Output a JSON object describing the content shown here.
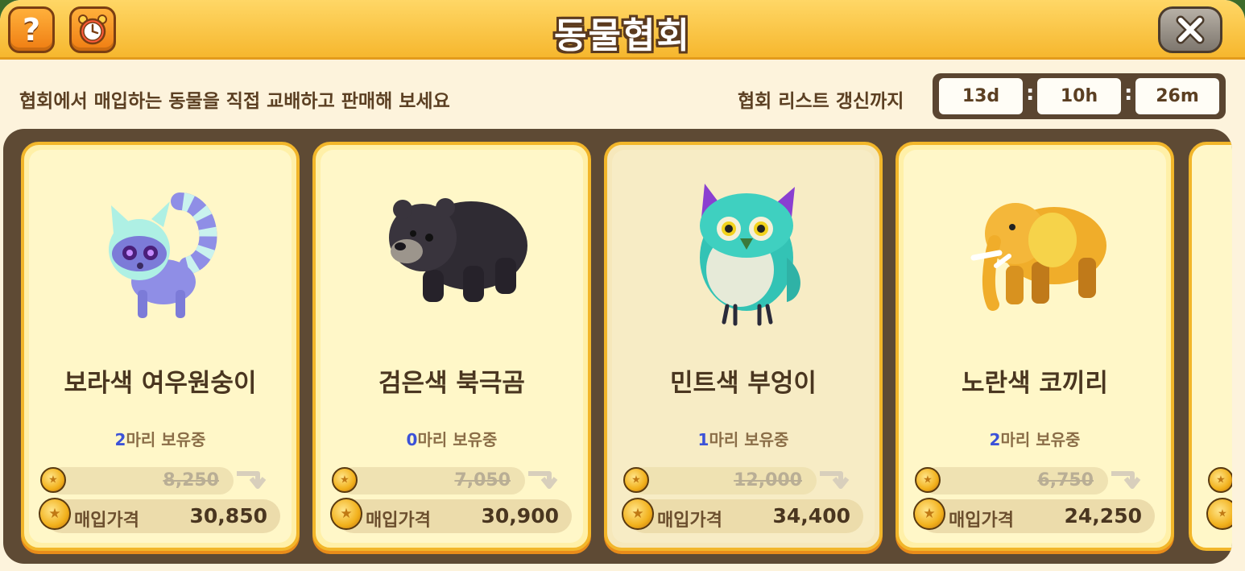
{
  "window": {
    "title": "동물협회",
    "subtitle": "협회에서 매입하는 동물을 직접 교배하고 판매해 보세요",
    "refresh_label": "협회 리스트 갱신까지",
    "help_label": "?"
  },
  "timer": {
    "days": "13d",
    "hours": "10h",
    "minutes": "26m",
    "separator": ":"
  },
  "cards": [
    {
      "name": "보라색 여우원숭이",
      "owned_count": "2",
      "owned_suffix": "마리 보유중",
      "old_price": "8,250",
      "buy_label": "매입가격",
      "buy_price": "30,850",
      "icon": "lemur-icon",
      "color": "#8f8ee6"
    },
    {
      "name": "검은색 북극곰",
      "owned_count": "0",
      "owned_suffix": "마리 보유중",
      "old_price": "7,050",
      "buy_label": "매입가격",
      "buy_price": "30,900",
      "icon": "bear-icon",
      "color": "#2f2b33"
    },
    {
      "name": "민트색 부엉이",
      "owned_count": "1",
      "owned_suffix": "마리 보유중",
      "old_price": "12,000",
      "buy_label": "매입가격",
      "buy_price": "34,400",
      "icon": "owl-icon",
      "color": "#33c3b5"
    },
    {
      "name": "노란색 코끼리",
      "owned_count": "2",
      "owned_suffix": "마리 보유중",
      "old_price": "6,750",
      "buy_label": "매입가격",
      "buy_price": "24,250",
      "icon": "elephant-icon",
      "color": "#f0ad2a"
    }
  ],
  "colors": {
    "titlebar": "#f6b72e",
    "panel_bg": "#fdf3dc",
    "list_bg": "#5e4a34",
    "card_border": "#f2b62a",
    "owned_count": "#3c52d8"
  }
}
